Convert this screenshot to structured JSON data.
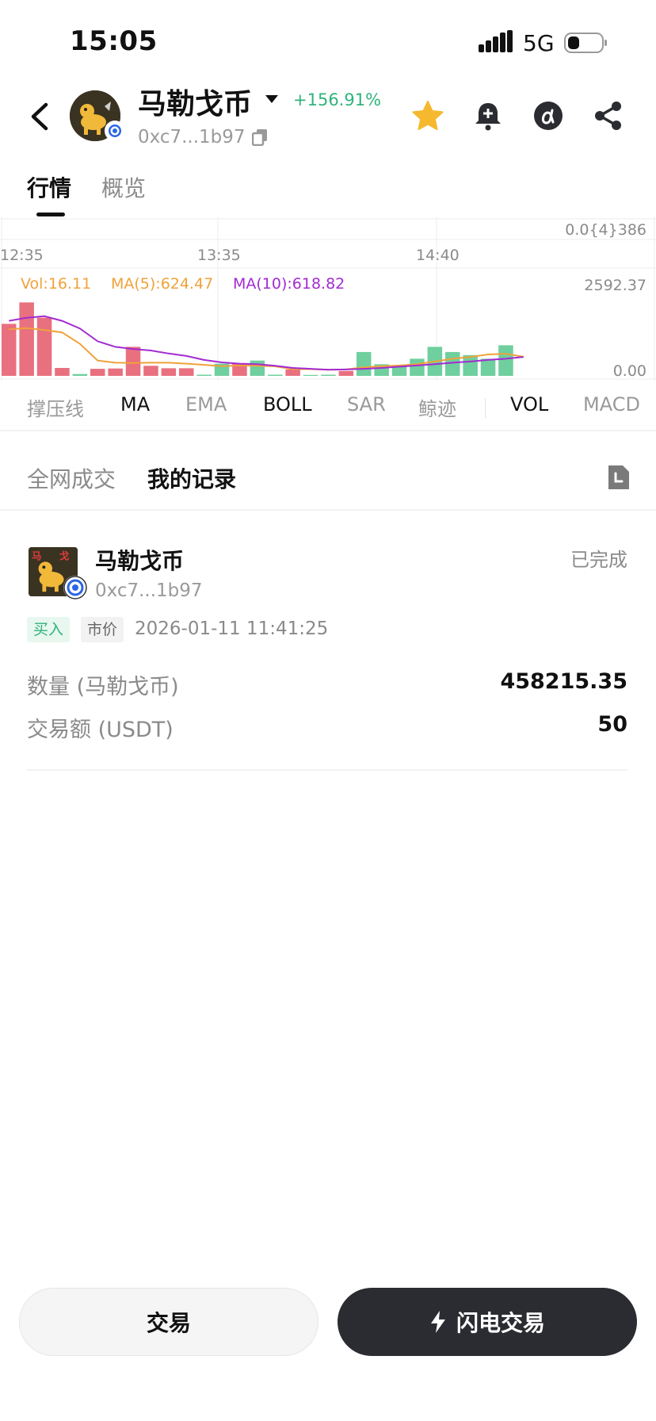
{
  "status": {
    "time": "15:05",
    "network": "5G"
  },
  "header": {
    "coin_name": "马勒戈币",
    "change": "+156.91%",
    "address": "0xc7...1b97",
    "icons": [
      "star-icon",
      "bell-plus-icon",
      "alpha-icon",
      "share-icon"
    ],
    "colors": {
      "favorite": "#f5b82e",
      "positive": "#2fb37c"
    }
  },
  "tabs": [
    "行情",
    "概览"
  ],
  "chart": {
    "price_label": "0.0{4}386",
    "time_labels": [
      "12:35",
      "13:35",
      "14:40"
    ],
    "legend": {
      "vol": "Vol:16.11",
      "ma5": "MA(5):624.47",
      "ma10": "MA(10):618.82"
    },
    "y_max_label": "2592.37",
    "y_min_label": "0.00",
    "colors": {
      "vol": "#f0a23a",
      "ma5": "#f0a23a",
      "ma10": "#a32bd1",
      "up": "#6fcf9e",
      "down": "#e8707f"
    }
  },
  "chart_data": {
    "type": "bar",
    "title": "",
    "ylim": [
      0,
      2592.37
    ],
    "series": [
      {
        "name": "Vol",
        "values": [
          1700,
          2400,
          1900,
          260,
          60,
          230,
          240,
          950,
          330,
          250,
          250,
          40,
          400,
          400,
          500,
          40,
          210,
          30,
          40,
          160,
          780,
          380,
          300,
          560,
          950,
          780,
          680,
          560,
          1000,
          0
        ],
        "direction": [
          "down",
          "down",
          "down",
          "down",
          "up",
          "down",
          "down",
          "down",
          "down",
          "down",
          "down",
          "up",
          "up",
          "down",
          "up",
          "up",
          "down",
          "up",
          "up",
          "down",
          "up",
          "up",
          "up",
          "up",
          "up",
          "up",
          "up",
          "up",
          "up",
          "up"
        ]
      },
      {
        "name": "MA(5)",
        "values": [
          1520,
          1560,
          1500,
          1420,
          1050,
          500,
          430,
          420,
          430,
          430,
          400,
          360,
          320,
          340,
          330,
          310,
          220,
          220,
          200,
          210,
          280,
          320,
          340,
          380,
          470,
          560,
          620,
          700,
          720,
          624.47
        ]
      },
      {
        "name": "MA(10)",
        "values": [
          1800,
          1900,
          1950,
          1800,
          1550,
          1130,
          950,
          880,
          830,
          730,
          650,
          520,
          440,
          400,
          380,
          330,
          260,
          230,
          200,
          210,
          230,
          260,
          300,
          340,
          380,
          430,
          470,
          520,
          560,
          618.82
        ]
      }
    ]
  },
  "indicators": {
    "main": [
      "撑压线",
      "MA",
      "EMA",
      "BOLL",
      "SAR",
      "鲸迹"
    ],
    "main_active": [
      "MA",
      "BOLL"
    ],
    "sub": [
      "VOL",
      "MACD"
    ],
    "sub_active": [
      "VOL"
    ]
  },
  "records": {
    "tabs": [
      "全网成交",
      "我的记录"
    ],
    "item": {
      "name": "马勒戈币",
      "address": "0xc7...1b97",
      "status": "已完成",
      "side": "买入",
      "order_type": "市价",
      "time": "2026-01-11 11:41:25",
      "qty_label": "数量 (马勒戈币)",
      "qty_value": "458215.35",
      "amount_label": "交易额 (USDT)",
      "amount_value": "50"
    }
  },
  "buttons": {
    "trade": "交易",
    "flash": "闪电交易"
  }
}
